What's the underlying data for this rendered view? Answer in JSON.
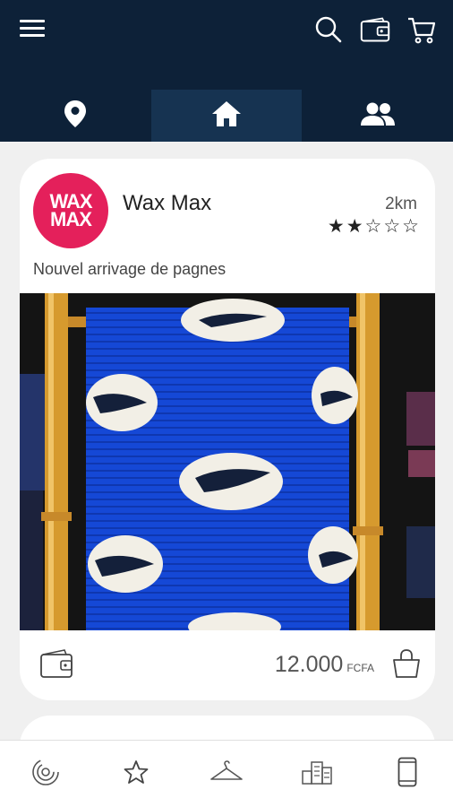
{
  "header": {
    "icons": [
      "menu-icon",
      "search-icon",
      "wallet-icon",
      "cart-icon"
    ]
  },
  "tabs": [
    {
      "icon": "location-pin-icon"
    },
    {
      "icon": "home-icon",
      "active": true
    },
    {
      "icon": "people-icon"
    }
  ],
  "post": {
    "logo": {
      "line1": "WAX",
      "line2": "MAX"
    },
    "shop_name": "Wax Max",
    "distance": "2km",
    "rating": 2,
    "rating_max": 5,
    "stars": [
      "★",
      "★",
      "☆",
      "☆",
      "☆"
    ],
    "description": "Nouvel arrivage de pagnes",
    "price_value": "12.000",
    "price_currency": "FCFA"
  },
  "bottom_nav": [
    {
      "icon": "spiral-icon"
    },
    {
      "icon": "star-icon"
    },
    {
      "icon": "hanger-icon"
    },
    {
      "icon": "buildings-icon"
    },
    {
      "icon": "phone-icon"
    }
  ]
}
